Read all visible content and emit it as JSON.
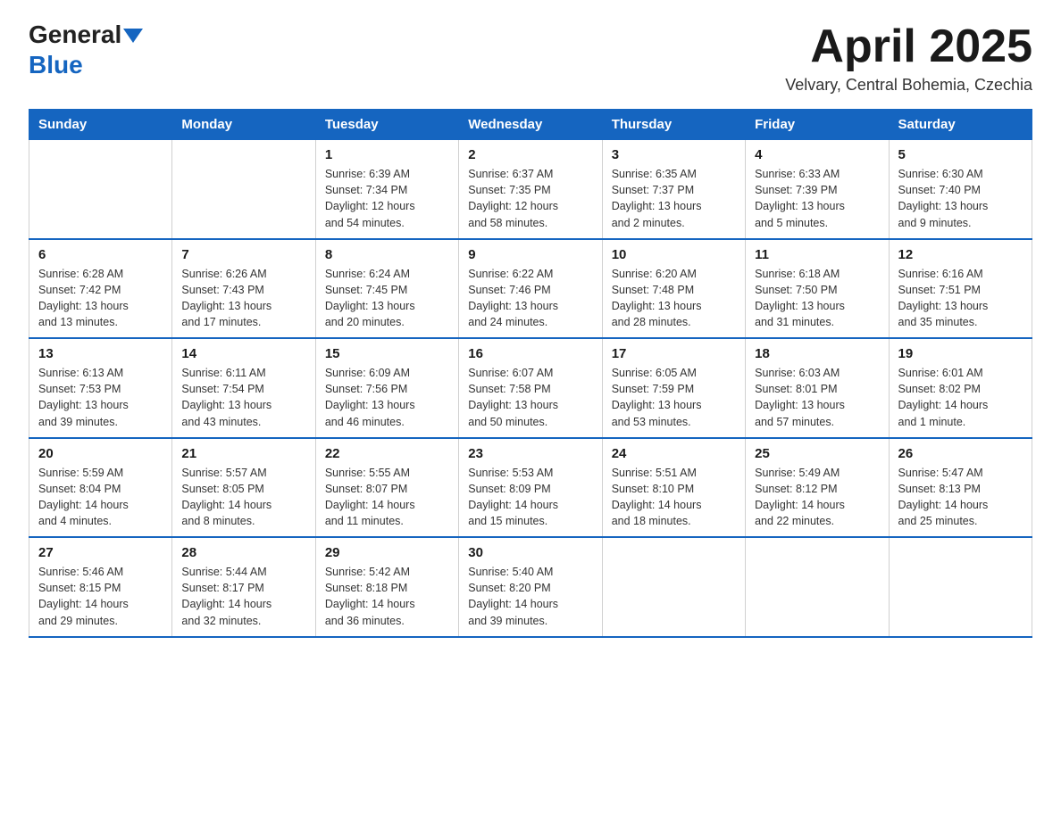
{
  "header": {
    "logo_general": "General",
    "logo_blue": "Blue",
    "month_title": "April 2025",
    "subtitle": "Velvary, Central Bohemia, Czechia"
  },
  "weekdays": [
    "Sunday",
    "Monday",
    "Tuesday",
    "Wednesday",
    "Thursday",
    "Friday",
    "Saturday"
  ],
  "weeks": [
    [
      {
        "day": "",
        "info": ""
      },
      {
        "day": "",
        "info": ""
      },
      {
        "day": "1",
        "info": "Sunrise: 6:39 AM\nSunset: 7:34 PM\nDaylight: 12 hours\nand 54 minutes."
      },
      {
        "day": "2",
        "info": "Sunrise: 6:37 AM\nSunset: 7:35 PM\nDaylight: 12 hours\nand 58 minutes."
      },
      {
        "day": "3",
        "info": "Sunrise: 6:35 AM\nSunset: 7:37 PM\nDaylight: 13 hours\nand 2 minutes."
      },
      {
        "day": "4",
        "info": "Sunrise: 6:33 AM\nSunset: 7:39 PM\nDaylight: 13 hours\nand 5 minutes."
      },
      {
        "day": "5",
        "info": "Sunrise: 6:30 AM\nSunset: 7:40 PM\nDaylight: 13 hours\nand 9 minutes."
      }
    ],
    [
      {
        "day": "6",
        "info": "Sunrise: 6:28 AM\nSunset: 7:42 PM\nDaylight: 13 hours\nand 13 minutes."
      },
      {
        "day": "7",
        "info": "Sunrise: 6:26 AM\nSunset: 7:43 PM\nDaylight: 13 hours\nand 17 minutes."
      },
      {
        "day": "8",
        "info": "Sunrise: 6:24 AM\nSunset: 7:45 PM\nDaylight: 13 hours\nand 20 minutes."
      },
      {
        "day": "9",
        "info": "Sunrise: 6:22 AM\nSunset: 7:46 PM\nDaylight: 13 hours\nand 24 minutes."
      },
      {
        "day": "10",
        "info": "Sunrise: 6:20 AM\nSunset: 7:48 PM\nDaylight: 13 hours\nand 28 minutes."
      },
      {
        "day": "11",
        "info": "Sunrise: 6:18 AM\nSunset: 7:50 PM\nDaylight: 13 hours\nand 31 minutes."
      },
      {
        "day": "12",
        "info": "Sunrise: 6:16 AM\nSunset: 7:51 PM\nDaylight: 13 hours\nand 35 minutes."
      }
    ],
    [
      {
        "day": "13",
        "info": "Sunrise: 6:13 AM\nSunset: 7:53 PM\nDaylight: 13 hours\nand 39 minutes."
      },
      {
        "day": "14",
        "info": "Sunrise: 6:11 AM\nSunset: 7:54 PM\nDaylight: 13 hours\nand 43 minutes."
      },
      {
        "day": "15",
        "info": "Sunrise: 6:09 AM\nSunset: 7:56 PM\nDaylight: 13 hours\nand 46 minutes."
      },
      {
        "day": "16",
        "info": "Sunrise: 6:07 AM\nSunset: 7:58 PM\nDaylight: 13 hours\nand 50 minutes."
      },
      {
        "day": "17",
        "info": "Sunrise: 6:05 AM\nSunset: 7:59 PM\nDaylight: 13 hours\nand 53 minutes."
      },
      {
        "day": "18",
        "info": "Sunrise: 6:03 AM\nSunset: 8:01 PM\nDaylight: 13 hours\nand 57 minutes."
      },
      {
        "day": "19",
        "info": "Sunrise: 6:01 AM\nSunset: 8:02 PM\nDaylight: 14 hours\nand 1 minute."
      }
    ],
    [
      {
        "day": "20",
        "info": "Sunrise: 5:59 AM\nSunset: 8:04 PM\nDaylight: 14 hours\nand 4 minutes."
      },
      {
        "day": "21",
        "info": "Sunrise: 5:57 AM\nSunset: 8:05 PM\nDaylight: 14 hours\nand 8 minutes."
      },
      {
        "day": "22",
        "info": "Sunrise: 5:55 AM\nSunset: 8:07 PM\nDaylight: 14 hours\nand 11 minutes."
      },
      {
        "day": "23",
        "info": "Sunrise: 5:53 AM\nSunset: 8:09 PM\nDaylight: 14 hours\nand 15 minutes."
      },
      {
        "day": "24",
        "info": "Sunrise: 5:51 AM\nSunset: 8:10 PM\nDaylight: 14 hours\nand 18 minutes."
      },
      {
        "day": "25",
        "info": "Sunrise: 5:49 AM\nSunset: 8:12 PM\nDaylight: 14 hours\nand 22 minutes."
      },
      {
        "day": "26",
        "info": "Sunrise: 5:47 AM\nSunset: 8:13 PM\nDaylight: 14 hours\nand 25 minutes."
      }
    ],
    [
      {
        "day": "27",
        "info": "Sunrise: 5:46 AM\nSunset: 8:15 PM\nDaylight: 14 hours\nand 29 minutes."
      },
      {
        "day": "28",
        "info": "Sunrise: 5:44 AM\nSunset: 8:17 PM\nDaylight: 14 hours\nand 32 minutes."
      },
      {
        "day": "29",
        "info": "Sunrise: 5:42 AM\nSunset: 8:18 PM\nDaylight: 14 hours\nand 36 minutes."
      },
      {
        "day": "30",
        "info": "Sunrise: 5:40 AM\nSunset: 8:20 PM\nDaylight: 14 hours\nand 39 minutes."
      },
      {
        "day": "",
        "info": ""
      },
      {
        "day": "",
        "info": ""
      },
      {
        "day": "",
        "info": ""
      }
    ]
  ]
}
